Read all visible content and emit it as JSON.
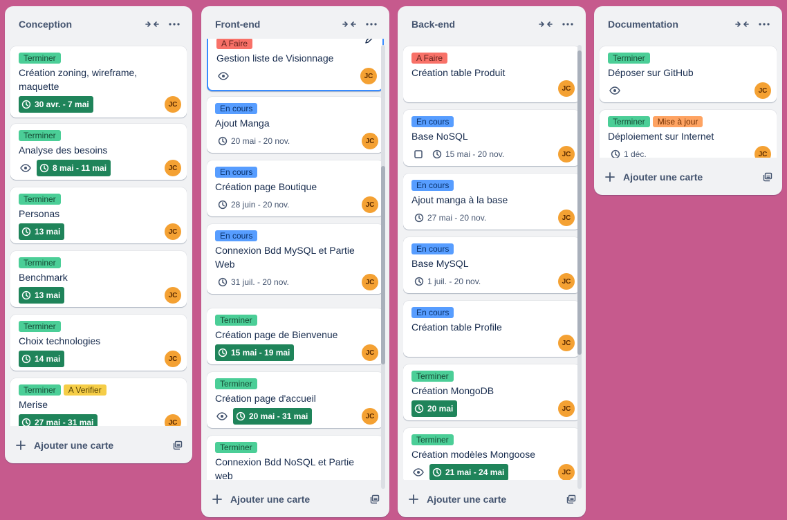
{
  "ui": {
    "avatar_initials": "JC",
    "add_card_label": "Ajouter une carte"
  },
  "colors": {
    "background": "#c65a8d",
    "list_bg": "#f1f2f4",
    "green_label": "#4bce97",
    "blue_label": "#579dff",
    "red_label": "#f87168",
    "yellow_label": "#f5cd47",
    "orange_label": "#fea362",
    "date_done": "#1f845a",
    "avatar": "#f4a133"
  },
  "lists": [
    {
      "title": "Conception",
      "cards": [
        {
          "labels": [
            {
              "text": "Terminer",
              "color": "green"
            }
          ],
          "title": "Création zoning, wireframe, maquette",
          "date": "30 avr. - 7 mai",
          "date_done": true
        },
        {
          "labels": [
            {
              "text": "Terminer",
              "color": "green"
            }
          ],
          "title": "Analyse des besoins",
          "eye": true,
          "date": "8 mai - 11 mai",
          "date_done": true
        },
        {
          "labels": [
            {
              "text": "Terminer",
              "color": "green"
            }
          ],
          "title": "Personas",
          "date": "13 mai",
          "date_done": true
        },
        {
          "labels": [
            {
              "text": "Terminer",
              "color": "green"
            }
          ],
          "title": "Benchmark",
          "date": "13 mai",
          "date_done": true
        },
        {
          "labels": [
            {
              "text": "Terminer",
              "color": "green"
            }
          ],
          "title": "Choix technologies",
          "date": "14 mai",
          "date_done": true
        },
        {
          "labels": [
            {
              "text": "Terminer",
              "color": "green"
            },
            {
              "text": "A Verifier",
              "color": "yellow"
            }
          ],
          "title": "Merise",
          "date": "27 mai - 31 mai",
          "date_done": true
        }
      ]
    },
    {
      "title": "Front-end",
      "cards": [
        {
          "labels": [
            {
              "text": "A Faire",
              "color": "red"
            }
          ],
          "title": "Gestion liste de Visionnage",
          "eye": true,
          "selected": true
        },
        {
          "labels": [
            {
              "text": "En cours",
              "color": "blue"
            }
          ],
          "title": "Ajout Manga",
          "date": "20 mai - 20 nov."
        },
        {
          "labels": [
            {
              "text": "En cours",
              "color": "blue"
            }
          ],
          "title": "Création page Boutique",
          "date": "28 juin - 20 nov."
        },
        {
          "labels": [
            {
              "text": "En cours",
              "color": "blue"
            }
          ],
          "title": "Connexion Bdd MySQL et Partie Web",
          "date": "31 juil. - 20 nov."
        },
        {
          "labels": [
            {
              "text": "Terminer",
              "color": "green"
            }
          ],
          "title": "Création page de Bienvenue",
          "date": "15 mai - 19 mai",
          "date_done": true
        },
        {
          "labels": [
            {
              "text": "Terminer",
              "color": "green"
            }
          ],
          "title": "Création page d'accueil",
          "eye": true,
          "date": "20 mai - 31 mai",
          "date_done": true
        },
        {
          "labels": [
            {
              "text": "Terminer",
              "color": "green"
            }
          ],
          "title": "Connexion Bdd NoSQL et Partie web",
          "eye": true,
          "date": "",
          "date_done": true
        }
      ]
    },
    {
      "title": "Back-end",
      "cards": [
        {
          "labels": [
            {
              "text": "A Faire",
              "color": "red"
            }
          ],
          "title": "Création table Produit"
        },
        {
          "labels": [
            {
              "text": "En cours",
              "color": "blue"
            }
          ],
          "title": "Base NoSQL",
          "checkbox": true,
          "date": "15 mai - 20 nov."
        },
        {
          "labels": [
            {
              "text": "En cours",
              "color": "blue"
            }
          ],
          "title": "Ajout manga à la base",
          "date": "27 mai - 20 nov."
        },
        {
          "labels": [
            {
              "text": "En cours",
              "color": "blue"
            }
          ],
          "title": "Base MySQL",
          "date": "1 juil. - 20 nov."
        },
        {
          "labels": [
            {
              "text": "En cours",
              "color": "blue"
            }
          ],
          "title": "Création table Profile"
        },
        {
          "labels": [
            {
              "text": "Terminer",
              "color": "green"
            }
          ],
          "title": "Création MongoDB",
          "date": "20 mai",
          "date_done": true
        },
        {
          "labels": [
            {
              "text": "Terminer",
              "color": "green"
            }
          ],
          "title": "Création modèles Mongoose",
          "eye": true,
          "date": "21 mai - 24 mai",
          "date_done": true
        }
      ]
    },
    {
      "title": "Documentation",
      "cards": [
        {
          "labels": [
            {
              "text": "Terminer",
              "color": "green"
            }
          ],
          "title": "Déposer sur GitHub",
          "eye": true
        },
        {
          "labels": [
            {
              "text": "Terminer",
              "color": "green"
            },
            {
              "text": "Mise à jour",
              "color": "orange"
            }
          ],
          "title": "Déploiement sur Internet",
          "date": "1 déc."
        }
      ]
    }
  ]
}
